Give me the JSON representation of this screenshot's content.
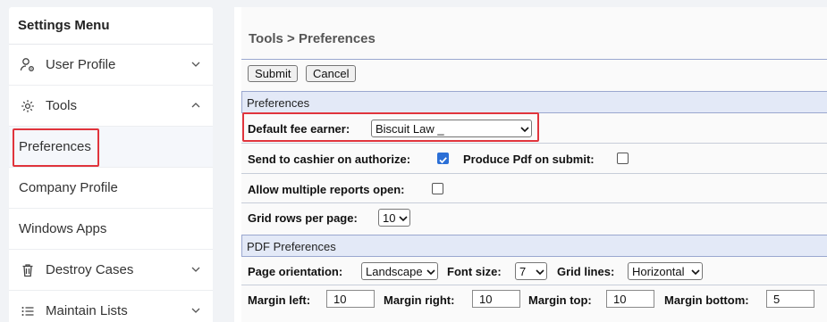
{
  "sidebar": {
    "title": "Settings Menu",
    "items": [
      {
        "label": "User Profile",
        "icon": "user-gear-icon"
      },
      {
        "label": "Tools",
        "icon": "gear-icon"
      },
      {
        "label": "Preferences"
      },
      {
        "label": "Company Profile"
      },
      {
        "label": "Windows Apps"
      },
      {
        "label": "Destroy Cases",
        "icon": "trash-icon"
      },
      {
        "label": "Maintain Lists",
        "icon": "list-icon"
      }
    ]
  },
  "main": {
    "breadcrumb": "Tools > Preferences",
    "submit_label": "Submit",
    "cancel_label": "Cancel",
    "section_preferences": "Preferences",
    "default_fee_earner_label": "Default fee earner:",
    "default_fee_earner_value": "Biscuit Law _",
    "send_to_cashier_label": "Send to cashier on authorize:",
    "send_to_cashier_checked": true,
    "produce_pdf_label": "Produce Pdf on submit:",
    "produce_pdf_checked": false,
    "allow_multiple_label": "Allow multiple reports open:",
    "allow_multiple_checked": false,
    "grid_rows_label": "Grid rows per page:",
    "grid_rows_value": "10",
    "section_pdf": "PDF Preferences",
    "page_orientation_label": "Page orientation:",
    "page_orientation_value": "Landscape",
    "font_size_label": "Font size:",
    "font_size_value": "7",
    "grid_lines_label": "Grid lines:",
    "grid_lines_value": "Horizontal",
    "margin_left_label": "Margin left:",
    "margin_left_value": "10",
    "margin_right_label": "Margin right:",
    "margin_right_value": "10",
    "margin_top_label": "Margin top:",
    "margin_top_value": "10",
    "margin_bottom_label": "Margin bottom:",
    "margin_bottom_value": "5"
  },
  "colors": {
    "highlight": "#e0343c",
    "section_header": "#e3e9f7",
    "checkbox_checked": "#2b6fd6"
  }
}
